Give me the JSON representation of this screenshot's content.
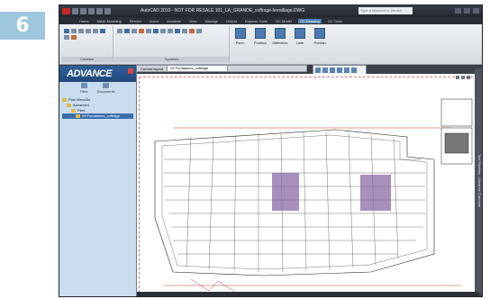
{
  "step": "6",
  "app": {
    "title": "AutoCAD 2010 - NOT FOR RESALE  101_LA_GRANDE_coffrage-ferraillage.DWG",
    "search_placeholder": "Type a keyword or phrase"
  },
  "tabs": [
    "Home",
    "Mesh Modeling",
    "Render",
    "Insert",
    "Annotate",
    "View",
    "Manage",
    "Output",
    "Express Tools",
    "GC Model",
    "GC Drawing",
    "GC Tools"
  ],
  "active_tab_index": 10,
  "ribbon": {
    "panels": [
      "Création",
      "Symbols"
    ],
    "big_buttons": [
      "New",
      "Renv.",
      "Position",
      "Différents",
      "Liste",
      "Publish"
    ]
  },
  "publish_popup": {
    "label": "Publish"
  },
  "docbar": {
    "label": "Current layout",
    "value": "09 Fondations_coffrage"
  },
  "sidebar": {
    "brand": "ADVANCE",
    "tools": [
      "Files",
      "Documents"
    ],
    "tree": [
      {
        "label": "Plan Mensilla",
        "level": 0,
        "selected": false
      },
      {
        "label": "Advanced",
        "level": 1,
        "selected": false
      },
      {
        "label": "Files",
        "level": 2,
        "selected": false
      },
      {
        "label": "09 Fondations_coffrage",
        "level": 3,
        "selected": true
      }
    ]
  },
  "side_vertical_title": "Tool Palettes - Advance Concrete"
}
